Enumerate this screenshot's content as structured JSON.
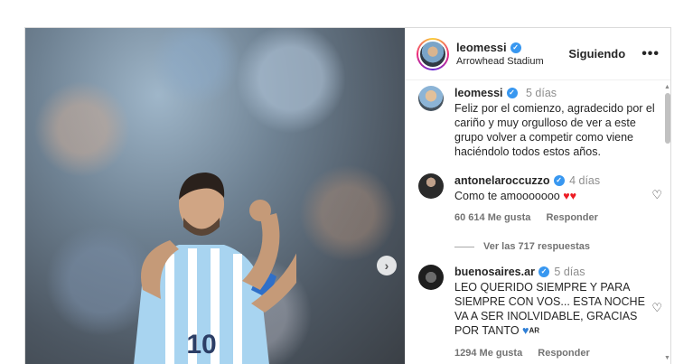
{
  "header": {
    "username": "leomessi",
    "location": "Arrowhead Stadium",
    "follow_label": "Siguiendo",
    "more_label": "•••"
  },
  "media": {
    "next_label": "›",
    "jersey_number": "10"
  },
  "caption": {
    "username": "leomessi",
    "time": "5 días",
    "text": "Feliz por el comienzo, agradecido por el cariño y muy orgulloso de ver a este grupo volver a competir como viene haciéndolo todos estos años."
  },
  "comments": [
    {
      "username": "antonelaroccuzzo",
      "time": "4 días",
      "text": "Como te amooooooo",
      "emoji": "♥♥",
      "likes": "60 614 Me gusta",
      "reply_label": "Responder",
      "view_replies": "Ver las 717 respuestas"
    },
    {
      "username": "buenosaires.ar",
      "time": "5 días",
      "text": "LEO QUERIDO SIEMPRE Y PARA SIEMPRE CON VOS... ESTA NOCHE VA A SER INOLVIDABLE, GRACIAS POR TANTO",
      "emoji": "♥",
      "flag": "AR",
      "likes": "1294 Me gusta",
      "reply_label": "Responder"
    }
  ],
  "icons": {
    "verified": "✓",
    "heart_outline": "♡",
    "scroll_up": "▲",
    "scroll_down": "▼"
  },
  "colors": {
    "verified_blue": "#3897f0",
    "heart_red": "#ed1c24",
    "heart_blue": "#2f7fd6"
  }
}
